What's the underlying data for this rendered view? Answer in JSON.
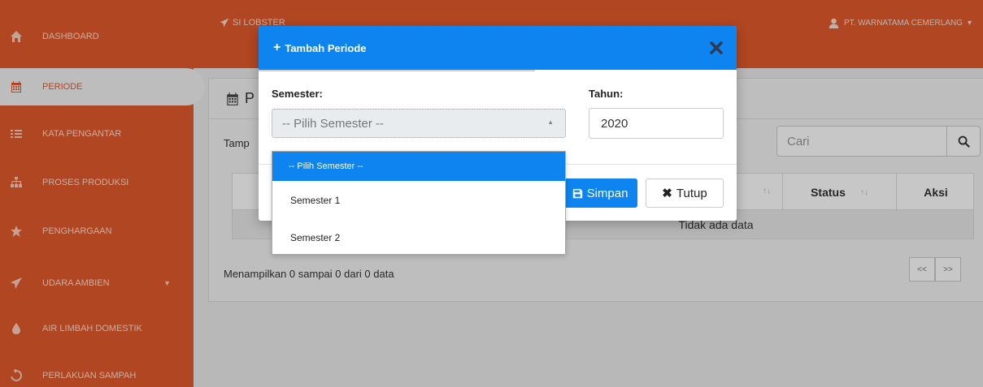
{
  "app": {
    "brand": "SI LOBSTER",
    "user": "PT. WARNATAMA CEMERLANG"
  },
  "sidebar": {
    "items": [
      {
        "label": "DASHBOARD",
        "icon": "home-icon"
      },
      {
        "label": "PERIODE",
        "icon": "calendar-icon",
        "active": true
      },
      {
        "label": "KATA PENGANTAR",
        "icon": "list-icon"
      },
      {
        "label": "PROSES PRODUKSI",
        "icon": "sitemap-icon"
      },
      {
        "label": "PENGHARGAAN",
        "icon": "star-icon"
      },
      {
        "label": "UDARA AMBIEN",
        "icon": "paper-plane-icon"
      },
      {
        "label": "AIR LIMBAH DOMESTIK",
        "icon": "tint-icon"
      },
      {
        "label": "PERLAKUAN SAMPAH",
        "icon": "recycle-icon"
      }
    ]
  },
  "content": {
    "title": "P",
    "show_label": "Tamp",
    "search_placeholder": "Cari",
    "columns": {
      "status": "Status",
      "aksi": "Aksi"
    },
    "empty_text": "Tidak ada data",
    "info": "Menampilkan 0 sampai 0 dari 0 data",
    "pager": {
      "prev": "<<",
      "next": ">>"
    }
  },
  "modal": {
    "title": "Tambah Periode",
    "semester_label": "Semester:",
    "tahun_label": "Tahun:",
    "semester_placeholder": "-- Pilih Semester --",
    "tahun_value": "2020",
    "save_label": "Simpan",
    "close_label": "Tutup",
    "options": [
      "-- Pilih Semester --",
      "Semester 1",
      "Semester 2"
    ]
  },
  "colors": {
    "sidebar": "#e35a2c",
    "primary": "#0d84ef"
  }
}
